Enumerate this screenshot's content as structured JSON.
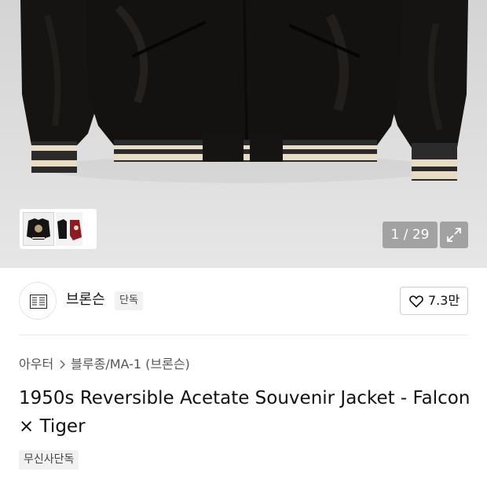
{
  "gallery": {
    "main_image_icon": "black-velvet-jacket-photo",
    "thumbnail_icons": [
      "jacket-front-thumbnail",
      "jacket-reverse-thumbnail"
    ],
    "counter": "1 / 29",
    "expand_icon": "expand-icon"
  },
  "brand": {
    "name": "브론슨",
    "badge": "단독",
    "logo_icon": "brand-logo-icon",
    "like_icon": "heart-outline-icon",
    "like_count": "7.3만"
  },
  "breadcrumb": {
    "items": [
      "아우터",
      "블루종/MA-1 (브론슨)"
    ],
    "separator_icon": "chevron-right-icon"
  },
  "product": {
    "title": "1950s Reversible Acetate Souvenir Jacket - Falcon × Tiger",
    "tag": "무신사단독"
  },
  "colors": {
    "gallery_bg": "#e2e2e2",
    "jacket": "#151311",
    "rib_cream": "#e8dcc4",
    "rib_dark": "#2b2b2b"
  }
}
